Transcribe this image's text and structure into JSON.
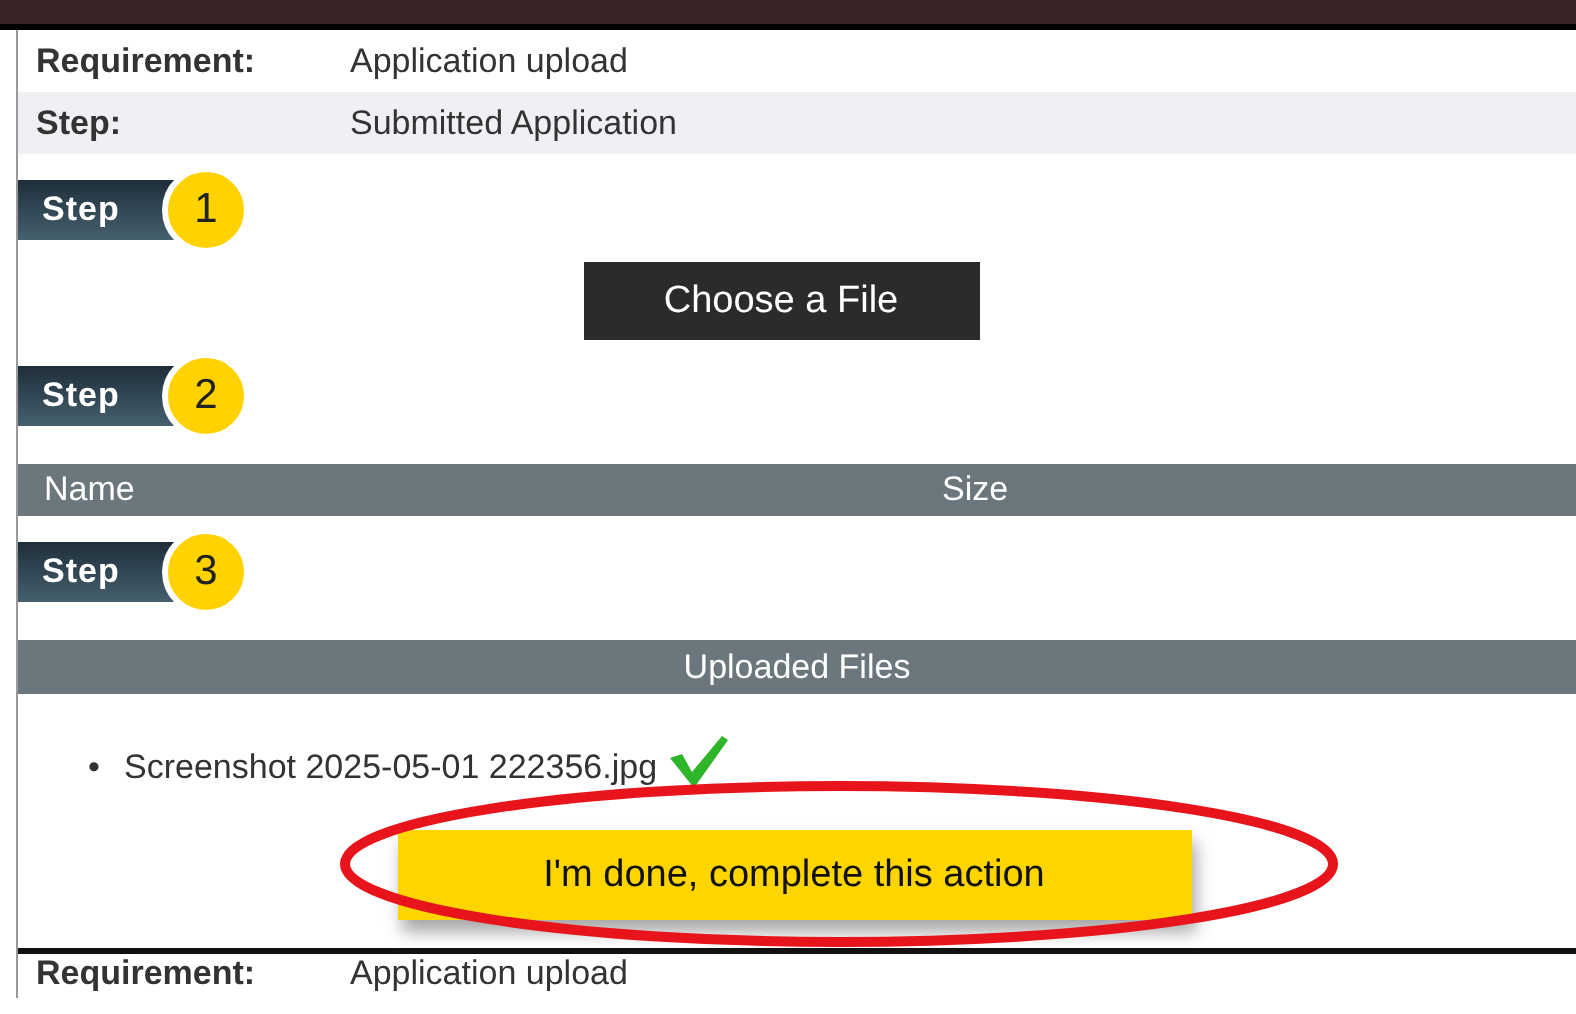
{
  "details": [
    {
      "label": "Requirement:",
      "value": "Application upload"
    },
    {
      "label": "Step:",
      "value": "Submitted Application"
    }
  ],
  "step_1": {
    "label": "Step",
    "number": "1"
  },
  "choose_button": "Choose a File",
  "step_2": {
    "label": "Step",
    "number": "2"
  },
  "file_table": {
    "columns": [
      "Name",
      "Size"
    ]
  },
  "step_3": {
    "label": "Step",
    "number": "3"
  },
  "uploaded_files": {
    "title": "Uploaded Files",
    "files": [
      {
        "bullet": "•",
        "name": "Screenshot 2025-05-01 222356.jpg",
        "verified": true
      }
    ]
  },
  "complete_button": "I'm done, complete this action",
  "next_details": [
    {
      "label": "Requirement:",
      "value": "Application upload"
    }
  ]
}
